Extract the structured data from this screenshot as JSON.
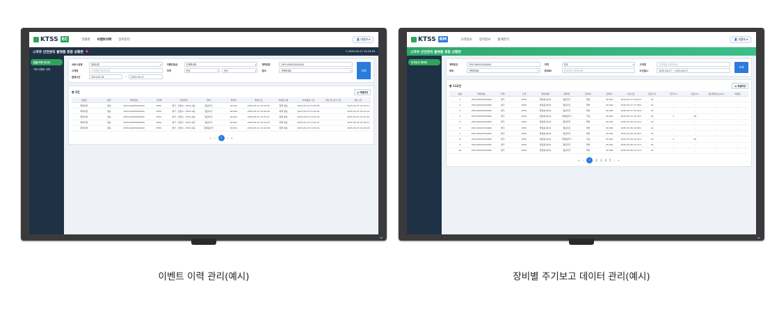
{
  "colors": {
    "ec_accent": "#2fa35c",
    "rm_accent": "#2a7bdc",
    "title_dark": "#1f3144",
    "title_green": "#2ea86a"
  },
  "left": {
    "logo": "KTSS",
    "tag": "EC",
    "nav": [
      "현황판",
      "이벤트이력",
      "장비관리"
    ],
    "user": "내정보 ▾",
    "title": "스마트 안전관리 플랫폼 종합 상황판",
    "timestamp": "2025-05-27 13:23:39",
    "side": [
      "알람/이력 리스트",
      "기타 이벤트 이력"
    ],
    "filters": [
      {
        "label": "서비스유형",
        "value": "위재난경",
        "type": "select"
      },
      {
        "label": "이벤트등급",
        "value": "선택하세요",
        "type": "select"
      },
      {
        "label": "계약번호",
        "value": "2501160025S40000",
        "type": "text"
      },
      {
        "label": "고객명",
        "value": "고객명을 입력하세요",
        "type": "placeholder"
      },
      {
        "label": "지역",
        "value": "전국",
        "type": "select"
      },
      {
        "label": "장비",
        "value": "선택하세요",
        "type": "select"
      },
      {
        "label": "발생시간",
        "value": "2024-05-26",
        "type": "text"
      },
      {
        "label": "~",
        "value": "2025-05-27",
        "type": "text"
      }
    ],
    "search_label": "조회",
    "count_label": "총 5건",
    "excel_label": "엑셀저장",
    "columns": [
      "이벤트",
      "등급",
      "계약번호",
      "고객명",
      "설치위치",
      "장비",
      "장비ID",
      "발생시간",
      "이벤트구분",
      "SMS발송 시간",
      "경보 및 조치 시간",
      "해소시간"
    ],
    "rows": [
      [
        "화재이전",
        "경보",
        "2501160025S40000",
        "KTSS",
        "경기 - 안양시 - KTSS 4층 - 동1",
        "열감지기",
        "00:062",
        "2025-05-23 15:34:35",
        "화재 경보",
        "2025-05-23 15:34:36",
        "",
        "2025-05-23 15:34:51"
      ],
      [
        "화재이전",
        "경보",
        "2501160025S40000",
        "KTSS",
        "경기 - 안양시 - KTSS 4층 - 동1",
        "열감지기",
        "00:062",
        "2025-05-23 15:26:28",
        "화재 경보",
        "2025-05-23 15:26:29",
        "",
        "2025-05-23 15:32:19"
      ],
      [
        "화재이전",
        "경보",
        "2501160025S40000",
        "KTSS",
        "경기 - 안양시 - KTSS 4층 - 동1",
        "열감지기",
        "00:062",
        "2025-05-23 15:25:31",
        "화재 경보",
        "2025-05-23 15:25:32",
        "",
        "2025-05-23 15:25:40"
      ],
      [
        "화재이전",
        "경보",
        "2501160025S40000",
        "KTSS",
        "경기 - 안양시 - KTSS 4층 - 전방",
        "열감지기",
        "00:061",
        "2025-05-23 15:24:23",
        "화재 경보",
        "2025-05-23 15:24:25",
        "",
        "2025-05-23 15:26:27"
      ],
      [
        "화재이전",
        "경보",
        "2501160025S40000",
        "KTSS",
        "경기 - 안양시 - KTSS 4층 - 주방",
        "화재감지기",
        "00:061",
        "2025-05-23 13:42:08",
        "화재 경보",
        "2025-05-23 13:42:09",
        "",
        "2025-05-23 13:44:48"
      ]
    ],
    "pager": {
      "first": "«",
      "prev": "‹",
      "current": "1",
      "next": "›",
      "last": "»"
    },
    "caption": "이벤트 이력 관리(예시)"
  },
  "right": {
    "logo": "KTSS",
    "tag": "RM",
    "nav": [
      "고객정보",
      "장비정보",
      "통계관리"
    ],
    "user": "내정보 ▾",
    "title": "스마트 안전관리 플랫폼 종합 상황판",
    "side": [
      "주기보고 데이터"
    ],
    "filters": [
      {
        "label": "계약번호",
        "value": "2501160025S40000",
        "type": "text"
      },
      {
        "label": "지역",
        "value": "전국",
        "type": "select"
      },
      {
        "label": "고객명",
        "value": "고객명을 입력하세요",
        "type": "placeholder"
      },
      {
        "label": "장비",
        "value": "선택하세요",
        "type": "select"
      },
      {
        "label": "장비ID",
        "value": "장비ID를 입력하세요",
        "type": "placeholder"
      },
      {
        "label": "수신일시",
        "value": "2025-04-27 ~ 2025-05-27",
        "type": "text"
      }
    ],
    "search_label": "조회",
    "count_label": "총 112건",
    "excel_label": "엑셀저장",
    "columns": [
      "번호",
      "계약번호",
      "지역",
      "고객",
      "장비설명",
      "장비명",
      "장비ID",
      "장비ID",
      "수집시간",
      "온도(℃)",
      "연기(%)",
      "습도(%)",
      "일산화탄소(ppm)",
      "이벤트"
    ],
    "rows": [
      [
        "1",
        "2501160025S40000",
        "경기",
        "KTSS",
        "빌딩용-센서1",
        "열감지기",
        "전방",
        "00:061",
        "2025-05-27 09:03:15",
        "22",
        "-",
        "-",
        "-",
        "-"
      ],
      [
        "2",
        "2501160025S40000",
        "경기",
        "KTSS",
        "빌딩용-센서1",
        "열감지기",
        "주방",
        "00:062",
        "2025-05-27 07:08:23",
        "22",
        "-",
        "-",
        "-",
        "-"
      ],
      [
        "3",
        "2501160025S40000",
        "경기",
        "KTSS",
        "빌딩용-센서1",
        "열감지기",
        "주방",
        "00:062",
        "2025-05-27 04:45:59",
        "23",
        "-",
        "-",
        "-",
        "-"
      ],
      [
        "4",
        "2501160025S40000",
        "경기",
        "KTSS",
        "빌딩용-센서1",
        "화재감지기",
        "거실",
        "00:061",
        "2025-05-27 02:34:38",
        "24",
        "2",
        "48",
        "-",
        "-"
      ],
      [
        "5",
        "2501160025S40000",
        "경기",
        "KTSS",
        "빌딩용-센서1",
        "열감지기",
        "전방",
        "00:061",
        "2025-05-26 22:19:20",
        "22",
        "-",
        "-",
        "-",
        "-"
      ],
      [
        "6",
        "2501160025S40000",
        "경기",
        "KTSS",
        "빌딩용-센서1",
        "열감지기",
        "주방",
        "00:062",
        "2025-05-26 20:08:05",
        "22",
        "-",
        "-",
        "-",
        "-"
      ],
      [
        "7",
        "2501160025S40000",
        "경기",
        "KTSS",
        "빌딩용-센서1",
        "열감지기",
        "주방",
        "00:062",
        "2025-05-26 18:56:13",
        "22",
        "-",
        "-",
        "-",
        "-"
      ],
      [
        "8",
        "2501160025S40000",
        "경기",
        "KTSS",
        "빌딩용-센서1",
        "화재감지기",
        "거실",
        "00:061",
        "2025-05-26 16:34:27",
        "20",
        "2",
        "46",
        "-",
        "-"
      ],
      [
        "9",
        "2501160025S40000",
        "경기",
        "KTSS",
        "빌딩용-센서1",
        "열감지기",
        "전방",
        "00:061",
        "2025-05-26 12:23:12",
        "22",
        "-",
        "-",
        "-",
        "-"
      ],
      [
        "10",
        "2501160025S40000",
        "경기",
        "KTSS",
        "빌딩용-센서1",
        "열감지기",
        "주방",
        "00:062",
        "2025-05-26 11:21:23",
        "22",
        "-",
        "-",
        "-",
        "-"
      ]
    ],
    "pager": {
      "first": "«",
      "prev": "‹",
      "pages": [
        "1",
        "2",
        "3",
        "4",
        "5"
      ],
      "next": "›",
      "last": "»"
    },
    "caption": "장비별 주기보고 데이터 관리(예시)"
  }
}
